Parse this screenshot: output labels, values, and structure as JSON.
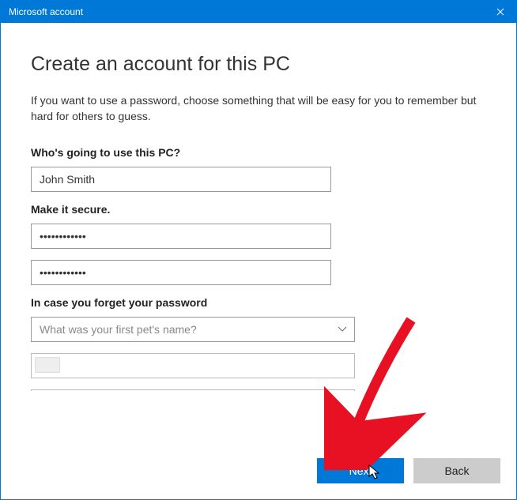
{
  "window": {
    "title": "Microsoft account"
  },
  "page": {
    "heading": "Create an account for this PC",
    "description": "If you want to use a password, choose something that will be easy for you to remember but hard for others to guess."
  },
  "user_section": {
    "label": "Who's going to use this PC?",
    "username": "John Smith"
  },
  "password_section": {
    "label": "Make it secure.",
    "password": "••••••••••••",
    "confirm": "••••••••••••"
  },
  "recovery_section": {
    "label": "In case you forget your password",
    "hint_question": "What was your first pet's name?",
    "hint_answer": ""
  },
  "buttons": {
    "next": "Next",
    "back": "Back"
  }
}
